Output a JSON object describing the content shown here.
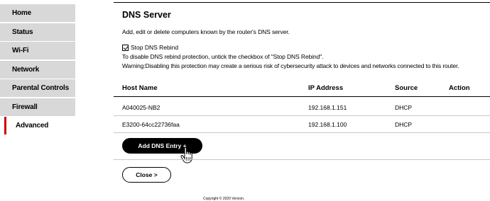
{
  "sidebar": {
    "items": [
      {
        "label": "Home"
      },
      {
        "label": "Status"
      },
      {
        "label": "Wi-Fi"
      },
      {
        "label": "Network"
      },
      {
        "label": "Parental Controls"
      },
      {
        "label": "Firewall"
      },
      {
        "label": "Advanced",
        "active": true
      }
    ]
  },
  "main": {
    "title": "DNS Server",
    "description": "Add, edit or delete computers known by the router's DNS server.",
    "rebind_checkbox_label": "Stop DNS Rebind",
    "rebind_checked": true,
    "rebind_info": "To disable DNS rebind protection, untick the checkbox of \"Stop DNS Rebind\".",
    "warning": "Warning:Disabling this protection may create a serious risk of cybersecurity attack to devices and networks connected to this router."
  },
  "table": {
    "headers": {
      "host": "Host Name",
      "ip": "IP Address",
      "source": "Source",
      "action": "Action"
    },
    "rows": [
      {
        "host": "A040025-NB2",
        "ip": "192.168.1.151",
        "source": "DHCP"
      },
      {
        "host": "E3200-64cc22736faa",
        "ip": "192.168.1.100",
        "source": "DHCP"
      }
    ]
  },
  "buttons": {
    "add_dns_entry": "Add DNS Entry +",
    "close": "Close >"
  },
  "footer": {
    "copyright": "Copyright © 2020 Verizon."
  },
  "colors": {
    "active_indicator": "#cd040b",
    "sidebar_bg": "#d8d8d8",
    "primary_button_bg": "#000000"
  }
}
